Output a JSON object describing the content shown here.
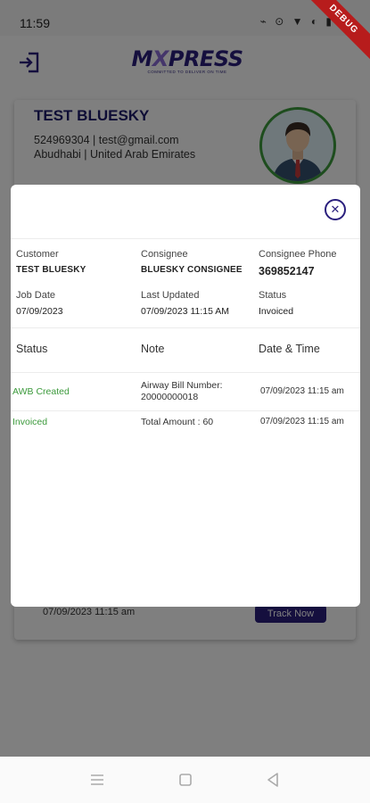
{
  "status_bar": {
    "time": "11:59",
    "icons": "⌁ ⊙ ▼ ◐ ▮",
    "debug_label": "DEBUG"
  },
  "app_bar": {
    "logo": "MXPRESS",
    "logo_left": "M",
    "logo_x": "X",
    "logo_rest": "PRESS",
    "logo_tagline": "COMMITTED TO DELIVER ON TIME"
  },
  "background": {
    "name": "TEST BLUESKY",
    "contact_line": "524969304 | test@gmail.com",
    "location_line": "Abudhabi | United Arab Emirates",
    "bottom_date": "07/09/2023 11:15 am",
    "track_button": "Track Now"
  },
  "dialog": {
    "close_symbol": "✕",
    "customer": {
      "label": "Customer",
      "value": "TEST BLUESKY"
    },
    "consignee": {
      "label": "Consignee",
      "value": "BLUESKY CONSIGNEE"
    },
    "consignee_phone": {
      "label": "Consignee Phone",
      "value": "369852147"
    },
    "job_date": {
      "label": "Job Date",
      "value": "07/09/2023"
    },
    "last_updated": {
      "label": "Last Updated",
      "value": "07/09/2023 11:15 AM"
    },
    "status": {
      "label": "Status",
      "value": "Invoiced"
    },
    "history_headers": {
      "status": "Status",
      "note": "Note",
      "datetime": "Date & Time"
    },
    "history": [
      {
        "status": "AWB Created",
        "note": "Airway Bill Number: 20000000018",
        "datetime": "07/09/2023 11:15 am"
      },
      {
        "status": "Invoiced",
        "note": "Total Amount : 60",
        "datetime": "07/09/2023 11:15 am"
      }
    ]
  },
  "colors": {
    "brand": "#2a1f7d",
    "success": "#3c9a3c",
    "debug": "#b71c1c"
  }
}
